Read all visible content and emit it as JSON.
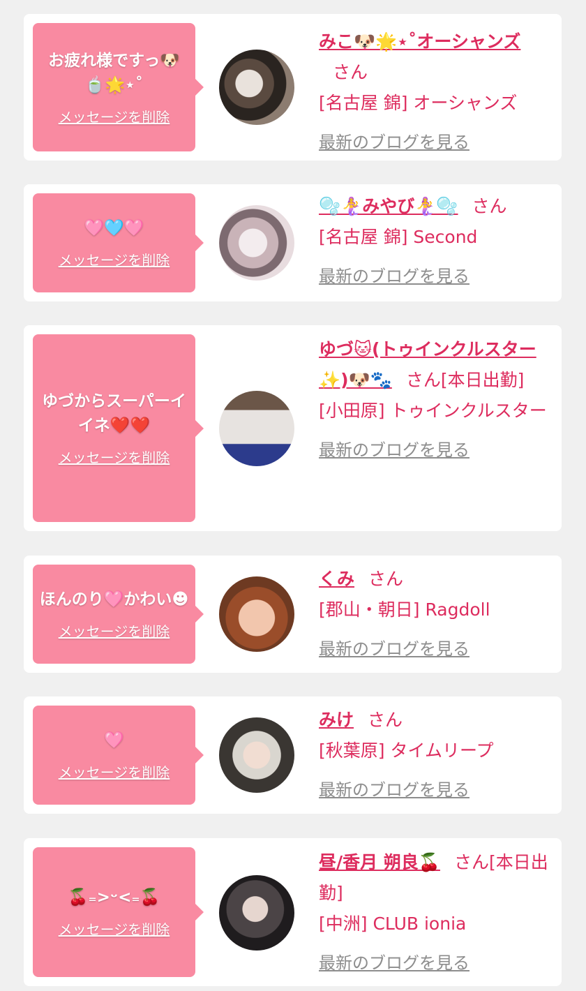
{
  "messages": [
    {
      "message": "お疲れ様ですっ🐶🍵🌟⋆˚",
      "delete_label": "メッセージを削除",
      "name": "みこ🐶🌟⋆˚オーシャンズ",
      "san": "さん",
      "shop": "[名古屋 錦] オーシャンズ",
      "blog_label": "最新のブログを見る"
    },
    {
      "message": "🩷🩵🩷",
      "delete_label": "メッセージを削除",
      "name": "🫧🧜‍♀️みやび🧜‍♀️🫧",
      "san": "さん",
      "shop": "[名古屋 錦] Second",
      "blog_label": "最新のブログを見る"
    },
    {
      "message": "ゆづからスーパーイイネ❤️❤️",
      "delete_label": "メッセージを削除",
      "name": "ゆづ🐱(トゥインクルスター✨)🐶🐾",
      "san": "さん[本日出勤]",
      "shop": "[小田原] トゥインクルスター",
      "blog_label": "最新のブログを見る"
    },
    {
      "message": "ほんのり🩷かわい☻",
      "delete_label": "メッセージを削除",
      "name": "くみ",
      "san": "さん",
      "shop": "[郡山・朝日] Ragdoll",
      "blog_label": "最新のブログを見る"
    },
    {
      "message": "🩷",
      "delete_label": "メッセージを削除",
      "name": "みけ",
      "san": "さん",
      "shop": "[秋葉原] タイムリープ",
      "blog_label": "最新のブログを見る"
    },
    {
      "message": "🍒₌>ᵕ<₌🍒",
      "delete_label": "メッセージを削除",
      "name": "昼/香月 朔良🍒",
      "san": "さん[本日出勤]",
      "shop": "[中洲] CLUB ionia",
      "blog_label": "最新のブログを見る"
    }
  ],
  "colors": {
    "accent_pink": "#dd2c5e",
    "bubble_pink": "#f98aa1",
    "link_gray": "#8d8d8d",
    "background": "#f0f0f0"
  }
}
